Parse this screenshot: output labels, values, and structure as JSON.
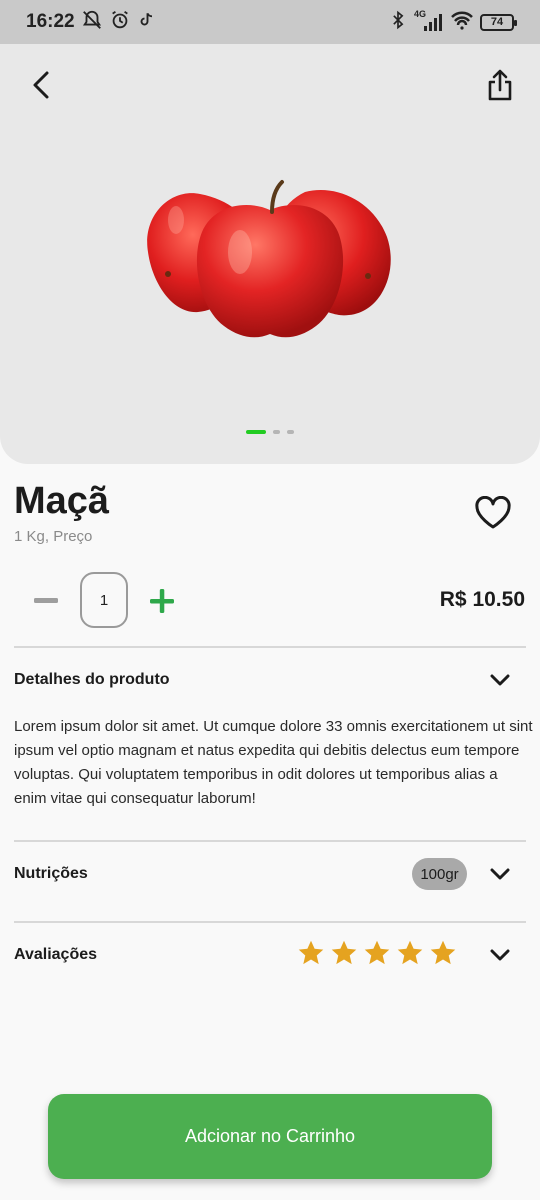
{
  "status_bar": {
    "time": "16:22",
    "network": "4G",
    "battery": "74",
    "left_icons": [
      "mute-icon",
      "alarm-icon",
      "tiktok-icon"
    ],
    "right_icons": [
      "bluetooth-icon",
      "signal-icon",
      "wifi-icon",
      "battery-icon"
    ]
  },
  "hero": {
    "carousel": {
      "total": 3,
      "active_index": 0
    },
    "icons": {
      "back": "chevron-left-icon",
      "share": "share-icon"
    }
  },
  "product": {
    "name": "Maçã",
    "subtitle": "1 Kg, Preço",
    "quantity": "1",
    "price": "R$ 10.50",
    "description": "Lorem ipsum dolor sit amet. Ut cumque dolore 33 omnis exercitationem ut sint ipsum vel optio magnam et natus expedita qui debitis delectus eum tempore voluptas. Qui voluptatem temporibus in odit dolores ut temporibus alias a enim vitae qui consequatur laborum!"
  },
  "sections": {
    "details": {
      "label": "Detalhes do produto"
    },
    "nutrition": {
      "label": "Nutrições",
      "badge": "100gr"
    },
    "reviews": {
      "label": "Avaliações",
      "rating": 5,
      "max": 5
    }
  },
  "cta": {
    "label": "Adcionar no Carrinho"
  },
  "colors": {
    "accent_green": "#4caf50",
    "plus_green": "#2ea84a",
    "dot_active": "#22cc22",
    "star": "#e5a320"
  }
}
